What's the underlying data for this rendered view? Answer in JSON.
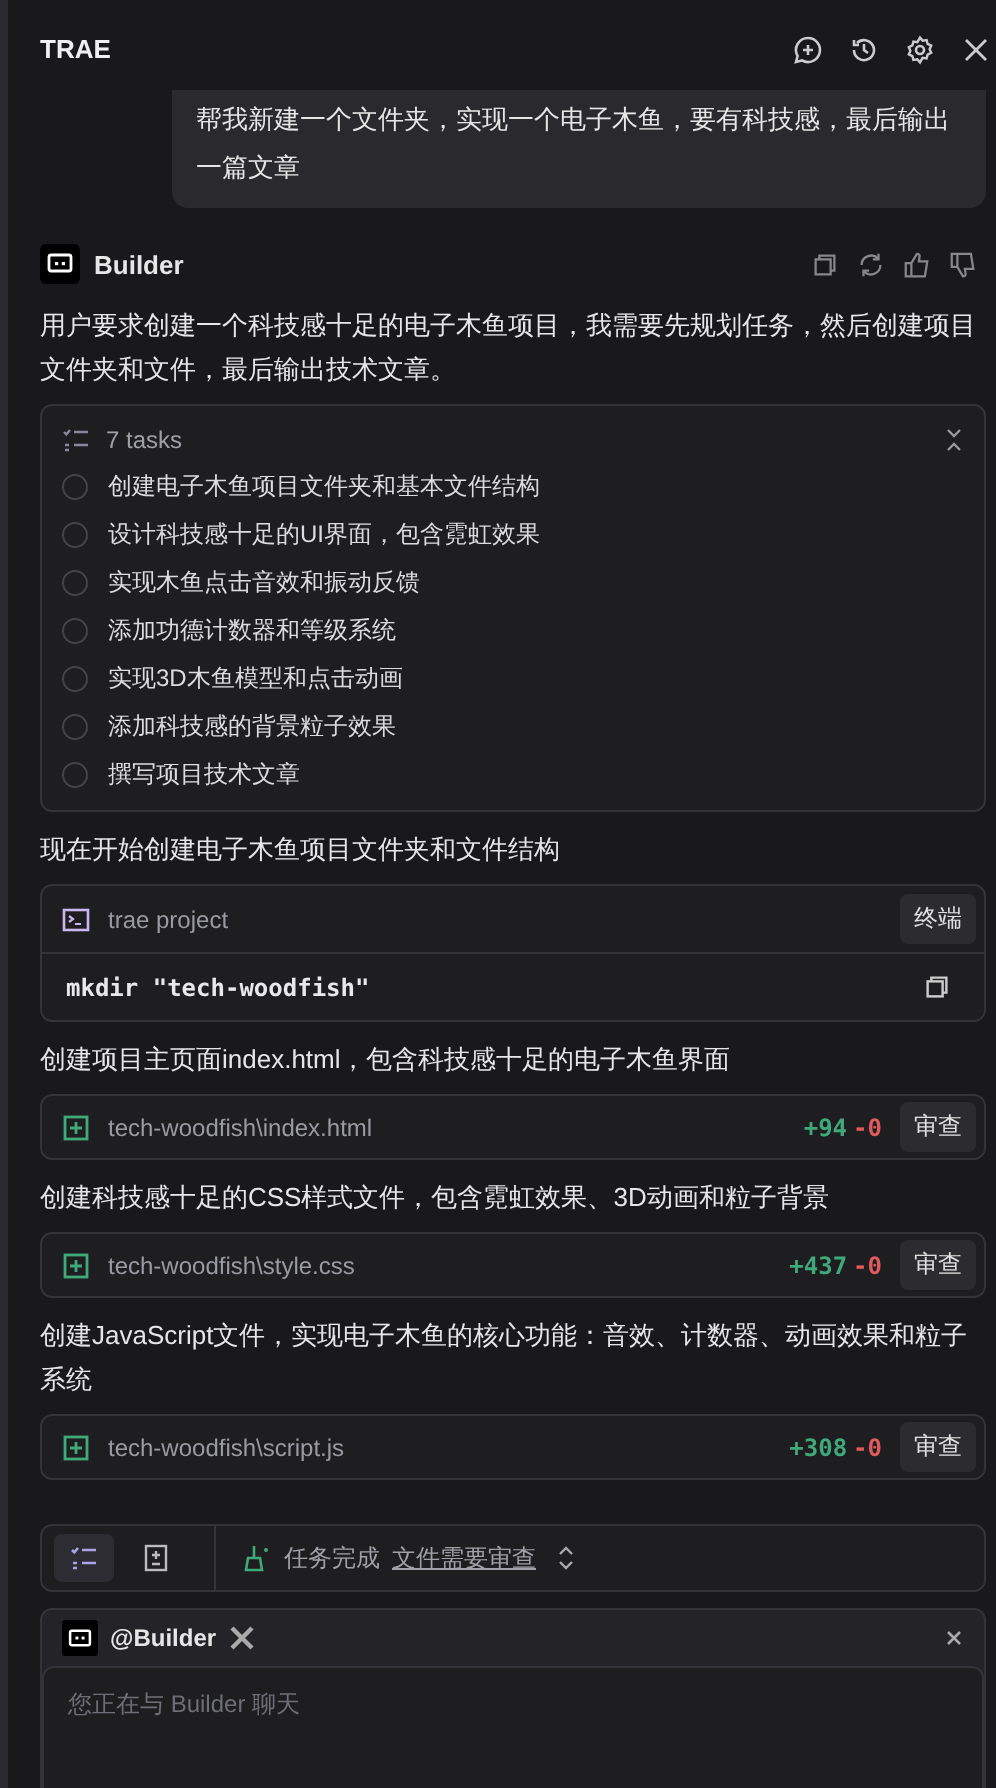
{
  "header": {
    "title": "TRAE"
  },
  "user_message": "帮我新建一个文件夹，实现一个电子木鱼，要有科技感，最后输出一篇文章",
  "assistant": {
    "name": "Builder"
  },
  "blocks": [
    {
      "kind": "text",
      "text": "用户要求创建一个科技感十足的电子木鱼项目，我需要先规划任务，然后创建项目文件夹和文件，最后输出技术文章。"
    },
    {
      "kind": "tasks",
      "count_label": "7 tasks",
      "items": [
        {
          "label": "创建电子木鱼项目文件夹和基本文件结构",
          "checked": false
        },
        {
          "label": "设计科技感十足的UI界面，包含霓虹效果",
          "checked": false
        },
        {
          "label": "实现木鱼点击音效和振动反馈",
          "checked": false
        },
        {
          "label": "添加功德计数器和等级系统",
          "checked": false
        },
        {
          "label": "实现3D木鱼模型和点击动画",
          "checked": false
        },
        {
          "label": "添加科技感的背景粒子效果",
          "checked": false
        },
        {
          "label": "撰写项目技术文章",
          "checked": false
        }
      ]
    },
    {
      "kind": "text",
      "text": "现在开始创建电子木鱼项目文件夹和文件结构"
    },
    {
      "kind": "terminal",
      "title": "trae project",
      "button": "终端",
      "command": "mkdir \"tech-woodfish\""
    },
    {
      "kind": "text",
      "text": "创建项目主页面index.html，包含科技感十足的电子木鱼界面"
    },
    {
      "kind": "file",
      "path": "tech-woodfish\\index.html",
      "added": "+94",
      "removed": "-0",
      "button": "审查"
    },
    {
      "kind": "text",
      "text": "创建科技感十足的CSS样式文件，包含霓虹效果、3D动画和粒子背景"
    },
    {
      "kind": "file",
      "path": "tech-woodfish\\style.css",
      "added": "+437",
      "removed": "-0",
      "button": "审查"
    },
    {
      "kind": "text",
      "text": "创建JavaScript文件，实现电子木鱼的核心功能：音效、计数器、动画效果和粒子系统"
    },
    {
      "kind": "file",
      "path": "tech-woodfish\\script.js",
      "added": "+308",
      "removed": "-0",
      "button": "审查"
    }
  ],
  "status_bar": {
    "status": "任务完成",
    "link": "文件需要审查"
  },
  "composer": {
    "mention": "@Builder",
    "placeholder": "您正在与 Builder 聊天"
  }
}
